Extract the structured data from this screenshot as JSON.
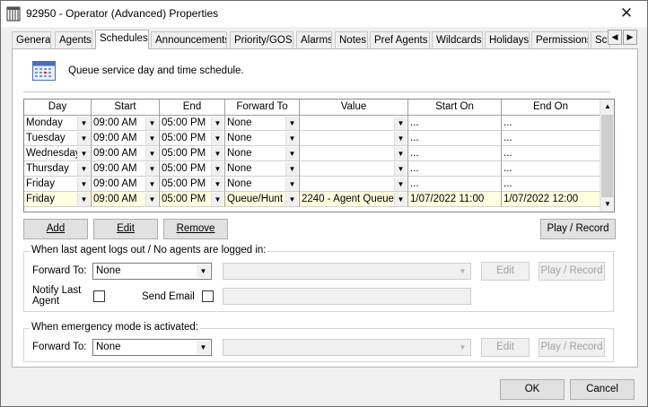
{
  "window": {
    "title": "92950 - Operator (Advanced) Properties",
    "close_glyph": "✕"
  },
  "tabs": [
    {
      "label": "General"
    },
    {
      "label": "Agents"
    },
    {
      "label": "Schedules",
      "active": true
    },
    {
      "label": "Announcements"
    },
    {
      "label": "Priority/GOS"
    },
    {
      "label": "Alarms"
    },
    {
      "label": "Notes"
    },
    {
      "label": "Pref Agents"
    },
    {
      "label": "Wildcards"
    },
    {
      "label": "Holidays"
    },
    {
      "label": "Permissions"
    },
    {
      "label": "Scr"
    }
  ],
  "tab_scroll": {
    "left": "◀",
    "right": "▶"
  },
  "schedules": {
    "description": "Queue service day and time schedule.",
    "columns": [
      "Day",
      "Start",
      "End",
      "Forward To",
      "Value",
      "Start On",
      "End On"
    ],
    "rows": [
      {
        "day": "Monday",
        "start": "09:00 AM",
        "end": "05:00 PM",
        "forward": "None",
        "value": "",
        "start_on": "...",
        "end_on": "..."
      },
      {
        "day": "Tuesday",
        "start": "09:00 AM",
        "end": "05:00 PM",
        "forward": "None",
        "value": "",
        "start_on": "...",
        "end_on": "..."
      },
      {
        "day": "Wednesday",
        "start": "09:00 AM",
        "end": "05:00 PM",
        "forward": "None",
        "value": "",
        "start_on": "...",
        "end_on": "..."
      },
      {
        "day": "Thursday",
        "start": "09:00 AM",
        "end": "05:00 PM",
        "forward": "None",
        "value": "",
        "start_on": "...",
        "end_on": "..."
      },
      {
        "day": "Friday",
        "start": "09:00 AM",
        "end": "05:00 PM",
        "forward": "None",
        "value": "",
        "start_on": "...",
        "end_on": "..."
      },
      {
        "day": "Friday",
        "start": "09:00 AM",
        "end": "05:00 PM",
        "forward": "Queue/Hunt",
        "value": "2240 - Agent Queue",
        "start_on": "1/07/2022 11:00",
        "end_on": "1/07/2022 12:00",
        "selected": true
      }
    ],
    "buttons": {
      "add": "Add",
      "edit": "Edit",
      "remove": "Remove",
      "play_record": "Play / Record"
    }
  },
  "last_agent_group": {
    "title": "When last agent logs out / No agents are logged in:",
    "forward_to_label": "Forward To:",
    "forward_to_value": "None",
    "notify_label": "Notify Last Agent",
    "send_email_label": "Send Email",
    "edit_label": "Edit",
    "play_record_label": "Play / Record"
  },
  "emergency_group": {
    "title": "When emergency mode is activated:",
    "forward_to_label": "Forward To:",
    "forward_to_value": "None",
    "edit_label": "Edit",
    "play_record_label": "Play / Record"
  },
  "footer": {
    "ok": "OK",
    "cancel": "Cancel"
  },
  "colors": {
    "selected_row": "#ffffe1",
    "panel_bg": "#ffffff",
    "window_bg": "#f0f0f0"
  }
}
